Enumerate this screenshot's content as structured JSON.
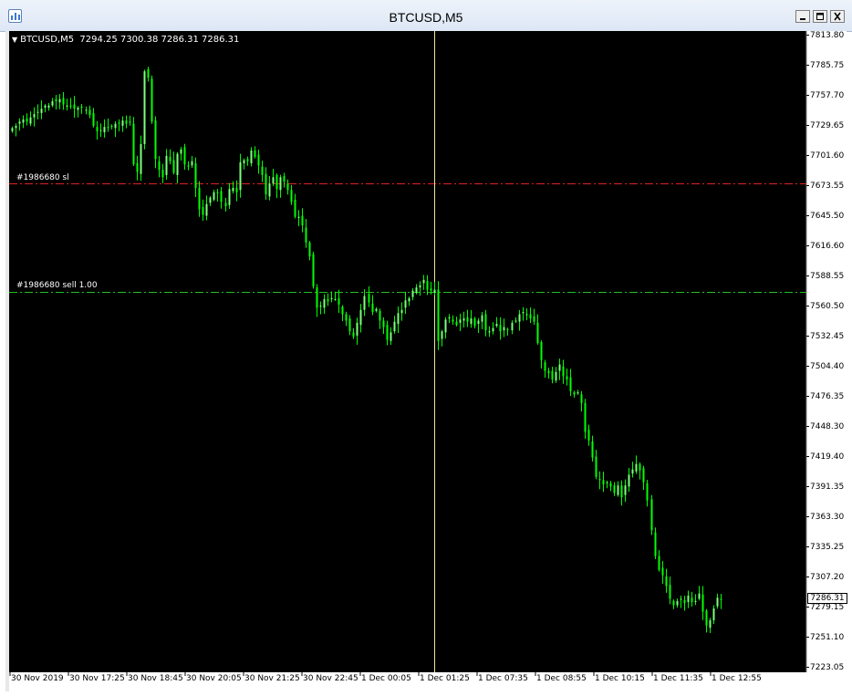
{
  "window": {
    "title": "BTCUSD,M5",
    "icon": "chart-window-icon",
    "controls": [
      "minimize-icon",
      "maximize-icon",
      "close-icon"
    ]
  },
  "legend": {
    "symbol": "BTCUSD,M5",
    "ohlc": "7294.25 7300.38 7286.31 7286.31",
    "arrow": "▼"
  },
  "orders": {
    "sl_label": "#1986680 sl",
    "sl_price": 7675,
    "sl_color": "#e02020",
    "sell_label": "#1986680 sell 1.00",
    "sell_price": 7574,
    "sell_color": "#20c020"
  },
  "current_price": "7286.31",
  "colors": {
    "background": "#000000",
    "candle": "#00ff00",
    "candle_up": "#7cff7c",
    "crosshair": "#e8e8a0"
  },
  "chart_data": {
    "type": "candlestick",
    "title": "BTCUSD,M5",
    "y_ticks": [
      "7813.80",
      "7785.75",
      "7757.70",
      "7729.65",
      "7701.60",
      "7673.55",
      "7645.50",
      "7616.60",
      "7588.55",
      "7560.50",
      "7532.45",
      "7504.40",
      "7476.35",
      "7448.30",
      "7419.40",
      "7391.35",
      "7363.30",
      "7335.25",
      "7307.20",
      "7279.15",
      "7251.10",
      "7223.05"
    ],
    "ylim": [
      7223.05,
      7813.8
    ],
    "x_ticks": [
      "30 Nov 2019",
      "30 Nov 17:25",
      "30 Nov 18:45",
      "30 Nov 20:05",
      "30 Nov 21:25",
      "30 Nov 22:45",
      "1 Dec 00:05",
      "1 Dec 01:25",
      "1 Dec 07:35",
      "1 Dec 08:55",
      "1 Dec 10:15",
      "1 Dec 11:35",
      "1 Dec 12:55"
    ],
    "crosshair_time": "1 Dec 01:25",
    "closes": [
      7727,
      7729,
      7733,
      7735,
      7733,
      7737,
      7740,
      7742,
      7745,
      7748,
      7748,
      7752,
      7752,
      7754,
      7749,
      7748,
      7747,
      7745,
      7746,
      7746,
      7744,
      7739,
      7729,
      7724,
      7725,
      7728,
      7727,
      7728,
      7731,
      7731,
      7734,
      7731,
      7732,
      7693,
      7686,
      7712,
      7780,
      7774,
      7733,
      7698,
      7688,
      7681,
      7701,
      7696,
      7685,
      7703,
      7707,
      7693,
      7691,
      7696,
      7671,
      7651,
      7646,
      7656,
      7662,
      7667,
      7666,
      7658,
      7654,
      7670,
      7671,
      7667,
      7695,
      7697,
      7696,
      7706,
      7700,
      7692,
      7683,
      7665,
      7675,
      7681,
      7670,
      7681,
      7677,
      7669,
      7658,
      7644,
      7644,
      7636,
      7620,
      7607,
      7579,
      7559,
      7561,
      7567,
      7565,
      7568,
      7567,
      7562,
      7553,
      7547,
      7537,
      7532,
      7545,
      7557,
      7570,
      7564,
      7555,
      7558,
      7547,
      7541,
      7529,
      7536,
      7546,
      7554,
      7557,
      7566,
      7568,
      7575,
      7578,
      7580,
      7585,
      7576,
      7575,
      7576,
      7528,
      7537,
      7548,
      7550,
      7546,
      7543,
      7548,
      7549,
      7546,
      7549,
      7542,
      7547,
      7552,
      7538,
      7537,
      7540,
      7544,
      7537,
      7541,
      7538,
      7545,
      7547,
      7553,
      7555,
      7553,
      7549,
      7546,
      7526,
      7510,
      7500,
      7498,
      7492,
      7499,
      7506,
      7495,
      7492,
      7481,
      7478,
      7480,
      7470,
      7443,
      7435,
      7419,
      7401,
      7398,
      7394,
      7396,
      7392,
      7386,
      7393,
      7382,
      7393,
      7403,
      7408,
      7413,
      7407,
      7396,
      7379,
      7351,
      7327,
      7314,
      7309,
      7299,
      7287,
      7281,
      7285,
      7287,
      7283,
      7290,
      7284,
      7285,
      7292,
      7275,
      7262,
      7267,
      7278,
      7288,
      7286
    ]
  }
}
